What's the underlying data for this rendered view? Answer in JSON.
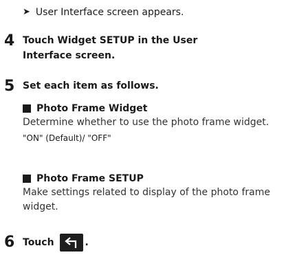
{
  "result_line": {
    "arrow": "➤",
    "text": "User Interface screen appears."
  },
  "steps": [
    {
      "number": "4",
      "text_before": "Touch ",
      "keyword": "Widget SETUP",
      "text_after": " in the User Interface screen."
    },
    {
      "number": "5",
      "text": "Set each item as follows."
    },
    {
      "number": "6",
      "text": "Touch",
      "trailing": ".",
      "icon": "back-arrow-icon"
    }
  ],
  "items": [
    {
      "heading": "Photo Frame Widget",
      "description": "Determine whether to use the photo frame widget.",
      "options": "\"ON\" (Default)/ \"OFF\""
    },
    {
      "heading": "Photo Frame SETUP",
      "description": "Make settings related to display of the photo frame widget."
    }
  ],
  "colors": {
    "text": "#1a1a1a",
    "button_bg": "#1e1e1e",
    "button_icon": "#ffffff"
  }
}
